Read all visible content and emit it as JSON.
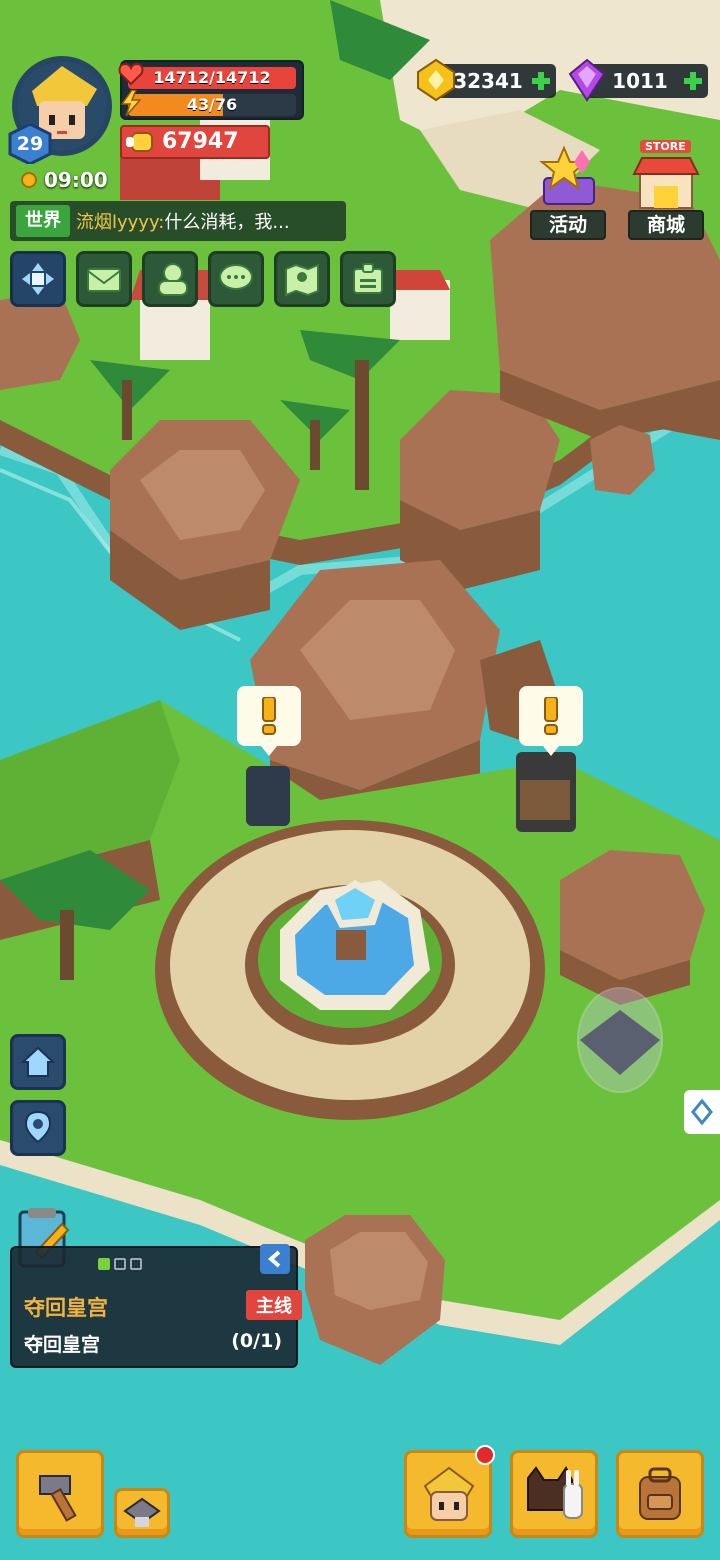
{
  "player": {
    "level": "29",
    "hp": "14712/14712",
    "hp_fraction": 1.0,
    "energy": "43/76",
    "energy_fraction": 0.566,
    "power": "67947",
    "time": "09:00"
  },
  "currency": {
    "gold": "32341",
    "gems": "1011"
  },
  "chat": {
    "channel": "世界",
    "sender": "流烟lyyyy:",
    "message": "什么消耗，我..."
  },
  "top_buttons": {
    "event_label": "活动",
    "store_label": "商城",
    "store_tag": "STORE"
  },
  "quest": {
    "title": "夺回皇宫",
    "tag": "主线",
    "objective": "夺回皇宫",
    "progress": "(0/1)",
    "page": 1,
    "pages": 3
  },
  "colors": {
    "sea": "#3cc7c4",
    "grass": "#6cc13c",
    "rock": "#b07a5c",
    "hp": "#e8443c",
    "energy": "#f28a1e",
    "button_gold": "#f4b92c"
  },
  "icons": {
    "menu": [
      "expand-icon",
      "mail-icon",
      "friends-icon",
      "chat-bubble-icon",
      "map-icon",
      "id-card-icon"
    ],
    "side": [
      "home-icon",
      "location-pin-icon"
    ],
    "bottom": [
      "hammer-icon",
      "build-icon",
      "hero-icon",
      "pets-icon",
      "backpack-icon"
    ]
  }
}
